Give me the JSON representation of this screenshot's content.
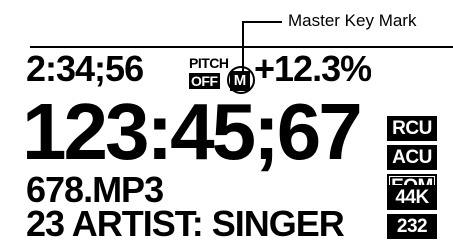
{
  "callout": {
    "label": "Master Key Mark"
  },
  "display": {
    "remain_time": "2:34;56",
    "pitch_label": "PITCH",
    "pitch_status": "OFF",
    "master_key": "M",
    "pitch_value": "+12.3%",
    "main_time": "123:45;67",
    "file_name": "678.MP3",
    "artist_line": "23 ARTIST: SINGER",
    "indicators": [
      "RCU",
      "ACU",
      "EOM",
      "44K",
      "232"
    ]
  },
  "colors": {
    "foreground": "#000000",
    "background": "#ffffff"
  }
}
